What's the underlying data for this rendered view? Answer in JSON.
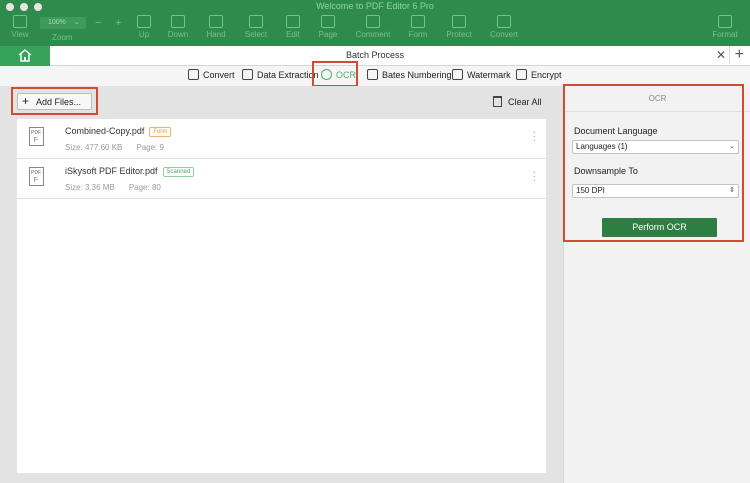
{
  "window": {
    "title": "Welcome to PDF Editor 6 Pro"
  },
  "toolbar": {
    "zoom_value": "100%",
    "zoom_label": "Zoom",
    "view": "View",
    "up": "Up",
    "down": "Down",
    "hand": "Hand",
    "select": "Select",
    "edit": "Edit",
    "page": "Page",
    "comment": "Comment",
    "form": "Form",
    "protect": "Protect",
    "convert": "Convert",
    "format": "Format"
  },
  "tabs": {
    "title": "Batch Process"
  },
  "functions": [
    {
      "label": "Convert"
    },
    {
      "label": "Data Extraction"
    },
    {
      "label": "OCR"
    },
    {
      "label": "Bates Numbering"
    },
    {
      "label": "Watermark"
    },
    {
      "label": "Encrypt"
    }
  ],
  "actions": {
    "add_files": "Add Files...",
    "clear_all": "Clear All"
  },
  "files": [
    {
      "name": "Combined-Copy.pdf",
      "badge": "Form",
      "size": "Size: 477.60 KB",
      "pages": "Page: 9"
    },
    {
      "name": "iSkysoft PDF Editor.pdf",
      "badge": "Scanned",
      "size": "Size: 3.36 MB",
      "pages": "Page: 80"
    }
  ],
  "ocr_panel": {
    "title": "OCR",
    "doc_language_label": "Document Language",
    "doc_language_value": "Languages (1)",
    "downsample_label": "Downsample To",
    "downsample_value": "150 DPI",
    "perform_button": "Perform OCR"
  },
  "colors": {
    "brand_green": "#2f8b4c",
    "active_green": "#4cb06b",
    "button_green": "#2e7d43",
    "highlight_red": "#d24b35"
  }
}
